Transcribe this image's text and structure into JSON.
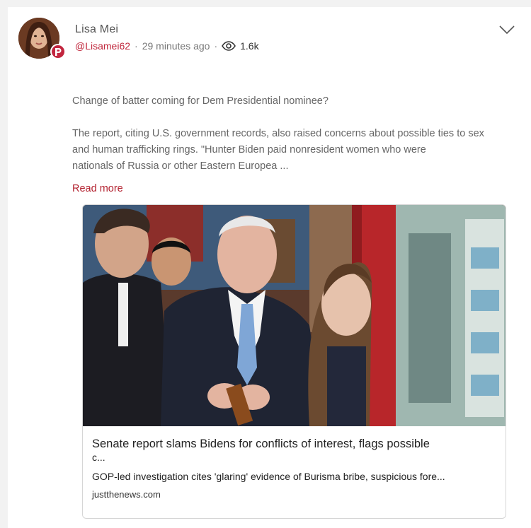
{
  "post": {
    "author_name": "Lisa Mei",
    "handle": "@Lisamei62",
    "time_ago": "29 minutes ago",
    "separator": "·",
    "views": "1.6k",
    "text_line1": "Change of batter coming for Dem Presidential nominee?",
    "text_para2_line1": "The report, citing U.S. government records, also raised concerns about possible ties to sex",
    "text_para2_line2": "and human trafficking rings. \"Hunter Biden paid nonresident women who were",
    "text_para2_line3": "nationals of Russia or other Eastern Europea ...",
    "read_more": "Read more"
  },
  "link_preview": {
    "title": "Senate report slams Bidens for conflicts of interest, flags possible",
    "title_cont": "c...",
    "description": "GOP-led investigation cites 'glaring' evidence of Burisma bribe, suspicious fore...",
    "domain": "justthenews.com"
  },
  "icons": {
    "badge": "parler-badge-icon",
    "views": "eye-icon",
    "menu": "chevron-down-icon"
  },
  "colors": {
    "accent": "#c0273c",
    "read_more": "#b3212f",
    "text": "#666666"
  }
}
